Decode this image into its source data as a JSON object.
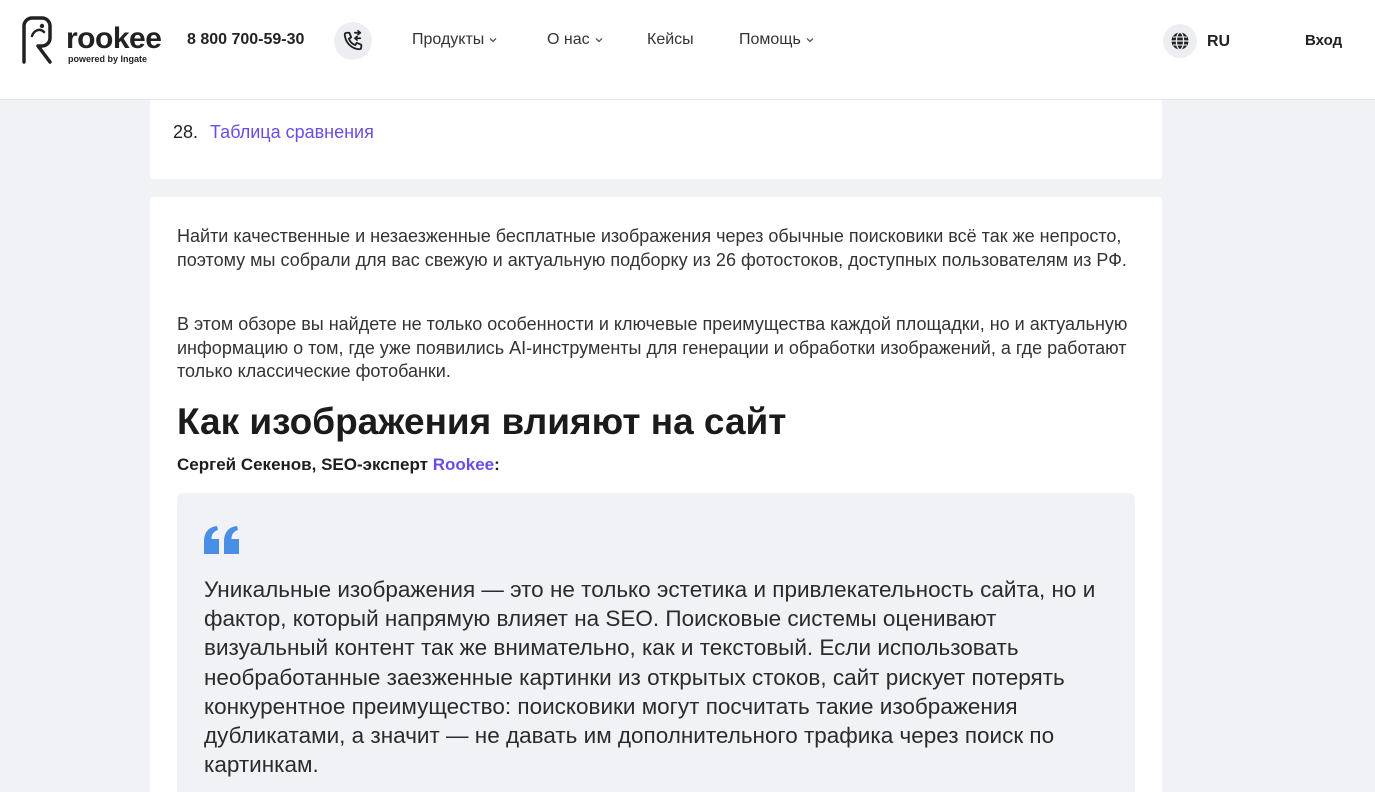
{
  "header": {
    "logo_text": "rookee",
    "logo_sub": "powered by Ingate",
    "phone": "8 800 700-59-30",
    "nav": [
      {
        "label": "Продукты",
        "has_dropdown": true
      },
      {
        "label": "О нас",
        "has_dropdown": true
      },
      {
        "label": "Кейсы",
        "has_dropdown": false
      },
      {
        "label": "Помощь",
        "has_dropdown": true
      }
    ],
    "language": "RU",
    "login_label": "Вход"
  },
  "toc": {
    "number": "28.",
    "link_label": "Таблица сравнения"
  },
  "article": {
    "paragraphs": [
      "Найти качественные и незаезженные бесплатные изображения через обычные поисковики всё так же непросто, поэтому мы собрали для вас свежую и актуальную подборку из 26 фотостоков, доступных пользователям из РФ.",
      "В этом обзоре вы найдете не только особенности и ключевые преимущества каждой площадки, но и актуальную информацию о том, где уже появились AI-инструменты для генерации и обработки изображений, а где работают только классические фотобанки."
    ],
    "heading": "Как изображения влияют на сайт",
    "author_prefix": "Сергей Секенов, SEO-эксперт ",
    "author_link": "Rookee",
    "author_suffix": ":",
    "quote": "Уникальные изображения — это не только эстетика и привлекательность сайта, но и фактор, который напрямую влияет на SEO. Поисковые системы оценивают визуальный контент так же внимательно, как и текстовый. Если использовать необработанные заезженные картинки из открытых стоков, сайт рискует потерять конкурентное преимущество: поисковики могут посчитать такие изображения дубликатами, а значит — не давать им дополнительного трафика через поиск по картинкам."
  },
  "colors": {
    "accent": "#6b4ce6",
    "quote_icon": "#4a8fe6",
    "page_bg": "#f1f2f5",
    "card_bg": "#ffffff"
  },
  "icons": {
    "logo": "rookee-logo-icon",
    "phone": "phone-callback-icon",
    "language": "globe-icon",
    "dropdown": "chevron-down-icon",
    "quote": "quote-icon"
  }
}
